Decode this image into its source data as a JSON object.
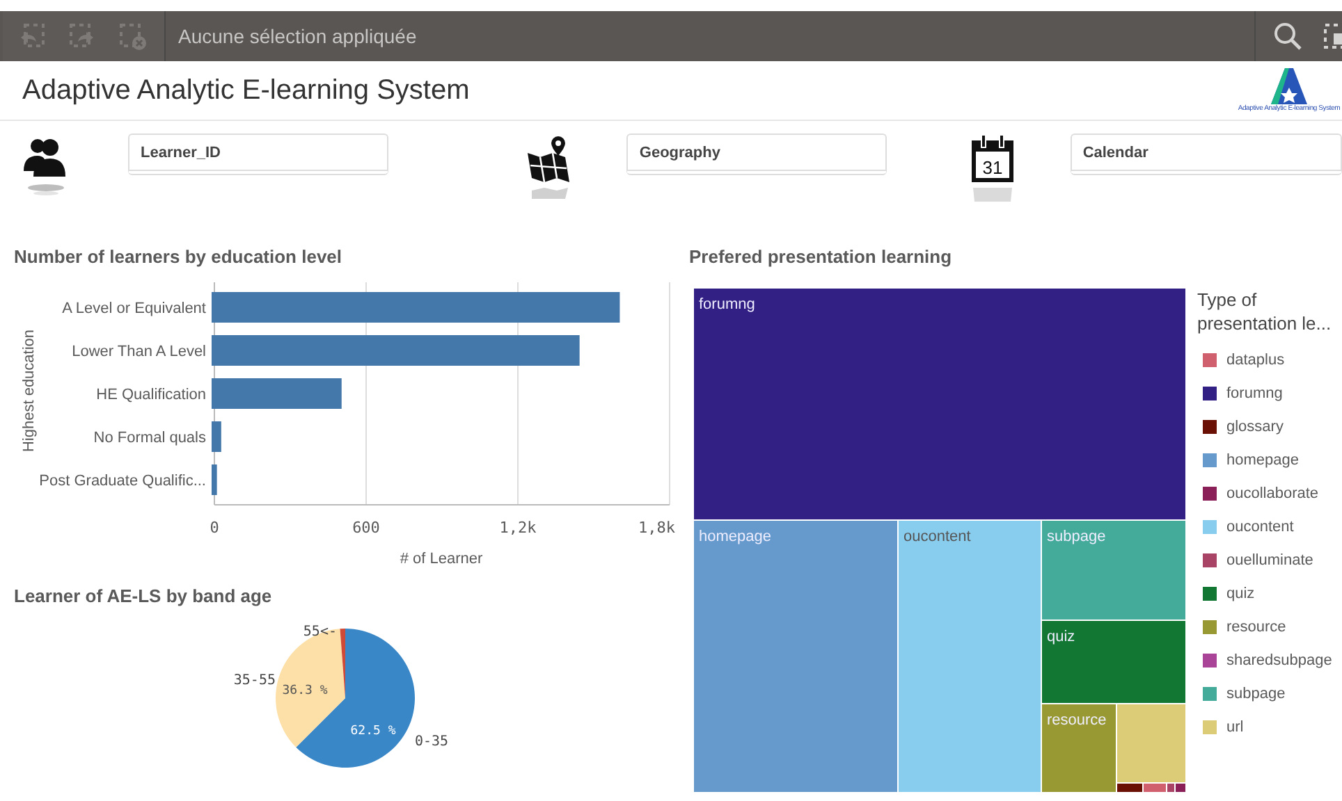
{
  "toolbar": {
    "selection_text": "Aucune sélection appliquée"
  },
  "header": {
    "title": "Adaptive Analytic E-learning System",
    "logo_caption": "Adaptive Analytic E-learning System"
  },
  "filters": [
    {
      "kind": "people",
      "label": "Learner_ID"
    },
    {
      "kind": "map",
      "label": "Geography"
    },
    {
      "kind": "calendar",
      "label": "Calendar",
      "day": "31"
    }
  ],
  "bar_chart": {
    "chart_data": {
      "type": "bar",
      "orientation": "horizontal",
      "title": "Number of learners by education level",
      "xlabel": "# of Learner",
      "ylabel": "Highest education",
      "categories": [
        "A Level or Equivalent",
        "Lower Than A Level",
        "HE Qualification",
        "No Formal quals",
        "Post Graduate Qualific..."
      ],
      "values": [
        1603,
        1444,
        503,
        27,
        10
      ],
      "xlim": [
        0,
        1800
      ],
      "xticks": [
        0,
        600,
        {
          "value": 1200,
          "label": "1,2k"
        },
        {
          "value": 1800,
          "label": "1,8k"
        }
      ]
    }
  },
  "pie_chart": {
    "chart_data": {
      "type": "pie",
      "title": "Learner of AE-LS by band age",
      "categories": [
        "0-35",
        "35-55",
        "55<-"
      ],
      "values": [
        62.5,
        36.3,
        1.2
      ],
      "value_labels": [
        "62.5 %",
        "36.3 %",
        null
      ]
    }
  },
  "treemap": {
    "title": "Prefered presentation learning",
    "tiles": [
      {
        "label": "forumng",
        "color": "#332085"
      },
      {
        "label": "homepage",
        "color": "#6699cc"
      },
      {
        "label": "oucontent",
        "color": "#88ccee"
      },
      {
        "label": "subpage",
        "color": "#44aa99"
      },
      {
        "label": "quiz",
        "color": "#117733"
      },
      {
        "label": "resource",
        "color": "#999933"
      },
      {
        "color": "#ddcc77"
      },
      {
        "color": "#6a1005"
      },
      {
        "color": "#d0606e"
      },
      {
        "color": "#aa4466"
      },
      {
        "color": "#8b1f57"
      }
    ],
    "legend": {
      "title": "Type of presentation le...",
      "items": [
        {
          "label": "dataplus",
          "color": "#d0606e"
        },
        {
          "label": "forumng",
          "color": "#332085"
        },
        {
          "label": "glossary",
          "color": "#6a1005"
        },
        {
          "label": "homepage",
          "color": "#6699cc"
        },
        {
          "label": "oucollaborate",
          "color": "#8b1f57"
        },
        {
          "label": "oucontent",
          "color": "#88ccee"
        },
        {
          "label": "ouelluminate",
          "color": "#aa4466"
        },
        {
          "label": "quiz",
          "color": "#117733"
        },
        {
          "label": "resource",
          "color": "#999933"
        },
        {
          "label": "sharedsubpage",
          "color": "#aa4499"
        },
        {
          "label": "subpage",
          "color": "#44aa99"
        },
        {
          "label": "url",
          "color": "#ddcc77"
        }
      ]
    }
  }
}
